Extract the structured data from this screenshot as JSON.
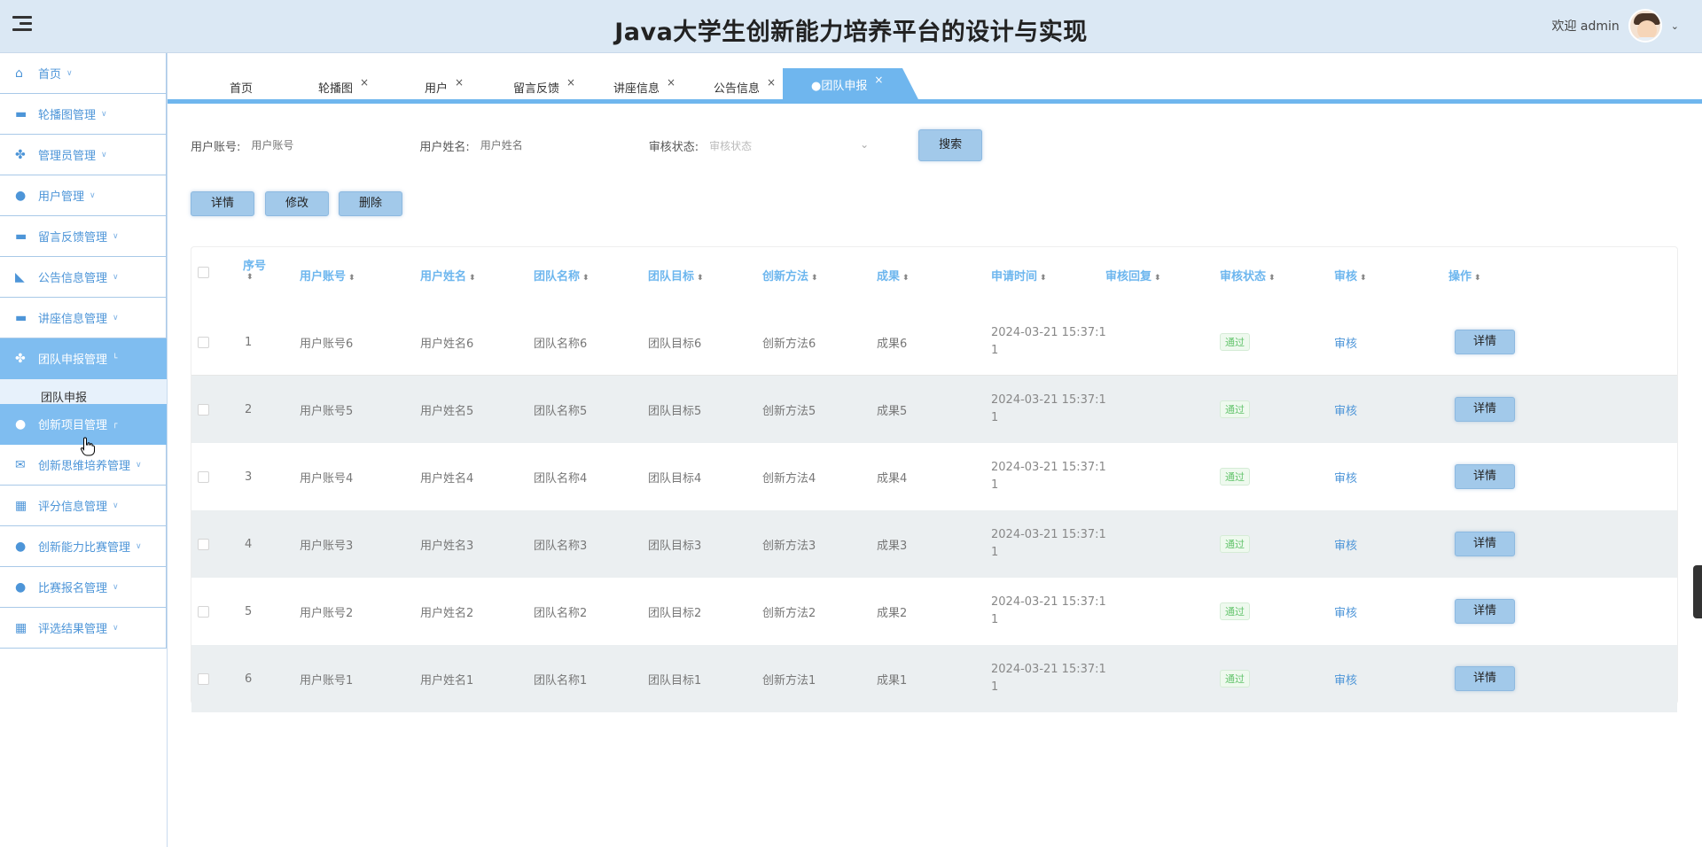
{
  "header": {
    "title": "Java大学生创新能力培养平台的设计与实现",
    "welcome": "欢迎 admin"
  },
  "sidebar": {
    "items": [
      {
        "label": "首页",
        "icon": "home-icon"
      },
      {
        "label": "轮播图管理",
        "icon": "carousel-icon"
      },
      {
        "label": "管理员管理",
        "icon": "admin-icon"
      },
      {
        "label": "用户管理",
        "icon": "user-icon"
      },
      {
        "label": "留言反馈管理",
        "icon": "message-icon"
      },
      {
        "label": "公告信息管理",
        "icon": "notice-icon"
      },
      {
        "label": "讲座信息管理",
        "icon": "lecture-icon"
      },
      {
        "label": "团队申报管理",
        "icon": "team-icon",
        "active": true
      },
      {
        "label": "创新项目管理",
        "icon": "project-icon",
        "active": true
      },
      {
        "label": "创新思维培养管理",
        "icon": "thinking-icon"
      },
      {
        "label": "评分信息管理",
        "icon": "score-icon"
      },
      {
        "label": "创新能力比赛管理",
        "icon": "contest-icon"
      },
      {
        "label": "比赛报名管理",
        "icon": "signup-icon"
      },
      {
        "label": "评选结果管理",
        "icon": "result-icon"
      }
    ],
    "submenu_label": "团队申报"
  },
  "tabs": [
    "首页",
    "轮播图",
    "用户",
    "留言反馈",
    "讲座信息",
    "公告信息",
    "●团队申报"
  ],
  "search": {
    "account_label": "用户账号:",
    "account_placeholder": "用户账号",
    "name_label": "用户姓名:",
    "name_placeholder": "用户姓名",
    "status_label": "审核状态:",
    "status_placeholder": "审核状态",
    "search_button": "搜索"
  },
  "actions": {
    "detail": "详情",
    "edit": "修改",
    "delete": "删除"
  },
  "table": {
    "columns": [
      "序号",
      "用户账号",
      "用户姓名",
      "团队名称",
      "团队目标",
      "创新方法",
      "成果",
      "申请时间",
      "审核回复",
      "审核状态",
      "审核",
      "操作"
    ],
    "rows": [
      {
        "index": "1",
        "account": "用户账号6",
        "name": "用户姓名6",
        "team": "团队名称6",
        "goal": "团队目标6",
        "method": "创新方法6",
        "result": "成果6",
        "time1": "2024-03-21 15:37:1",
        "time2": "1",
        "reply": "",
        "status": "通过",
        "review": "审核",
        "op": "详情"
      },
      {
        "index": "2",
        "account": "用户账号5",
        "name": "用户姓名5",
        "team": "团队名称5",
        "goal": "团队目标5",
        "method": "创新方法5",
        "result": "成果5",
        "time1": "2024-03-21 15:37:1",
        "time2": "1",
        "reply": "",
        "status": "通过",
        "review": "审核",
        "op": "详情"
      },
      {
        "index": "3",
        "account": "用户账号4",
        "name": "用户姓名4",
        "team": "团队名称4",
        "goal": "团队目标4",
        "method": "创新方法4",
        "result": "成果4",
        "time1": "2024-03-21 15:37:1",
        "time2": "1",
        "reply": "",
        "status": "通过",
        "review": "审核",
        "op": "详情"
      },
      {
        "index": "4",
        "account": "用户账号3",
        "name": "用户姓名3",
        "team": "团队名称3",
        "goal": "团队目标3",
        "method": "创新方法3",
        "result": "成果3",
        "time1": "2024-03-21 15:37:1",
        "time2": "1",
        "reply": "",
        "status": "通过",
        "review": "审核",
        "op": "详情"
      },
      {
        "index": "5",
        "account": "用户账号2",
        "name": "用户姓名2",
        "team": "团队名称2",
        "goal": "团队目标2",
        "method": "创新方法2",
        "result": "成果2",
        "time1": "2024-03-21 15:37:1",
        "time2": "1",
        "reply": "",
        "status": "通过",
        "review": "审核",
        "op": "详情"
      },
      {
        "index": "6",
        "account": "用户账号1",
        "name": "用户姓名1",
        "team": "团队名称1",
        "goal": "团队目标1",
        "method": "创新方法1",
        "result": "成果1",
        "time1": "2024-03-21 15:37:1",
        "time2": "1",
        "reply": "",
        "status": "通过",
        "review": "审核",
        "op": "详情"
      }
    ]
  },
  "colors": {
    "accent": "#6fb6ee",
    "header_bg": "#dbe8f4",
    "active_menu": "#7fbdf0",
    "status_green": "#63c46c"
  }
}
